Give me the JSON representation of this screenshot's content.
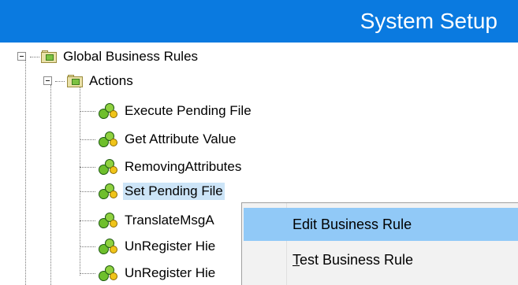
{
  "header": {
    "title": "System Setup",
    "background_color": "#0a7ae0"
  },
  "tree": {
    "root": {
      "label": "Global Business Rules",
      "icon": "folder-icon"
    },
    "actions": {
      "label": "Actions",
      "icon": "folder-icon"
    },
    "items": [
      {
        "label": "Execute Pending File",
        "icon": "business-rule-icon"
      },
      {
        "label": "Get Attribute Value",
        "icon": "business-rule-icon"
      },
      {
        "label": "RemovingAttributes",
        "icon": "business-rule-icon"
      },
      {
        "label": "Set Pending File",
        "icon": "business-rule-icon",
        "selected": true
      },
      {
        "label": "TranslateMsgA",
        "icon": "business-rule-icon"
      },
      {
        "label": "UnRegister Hie",
        "icon": "business-rule-icon"
      },
      {
        "label": "UnRegister Hie",
        "icon": "business-rule-icon"
      }
    ]
  },
  "context_menu": {
    "items": [
      {
        "label": "Edit Business Rule",
        "highlighted": true
      },
      {
        "label": "Test Business Rule",
        "mnemonic": "T"
      }
    ],
    "highlight_color": "#91c9f7"
  }
}
